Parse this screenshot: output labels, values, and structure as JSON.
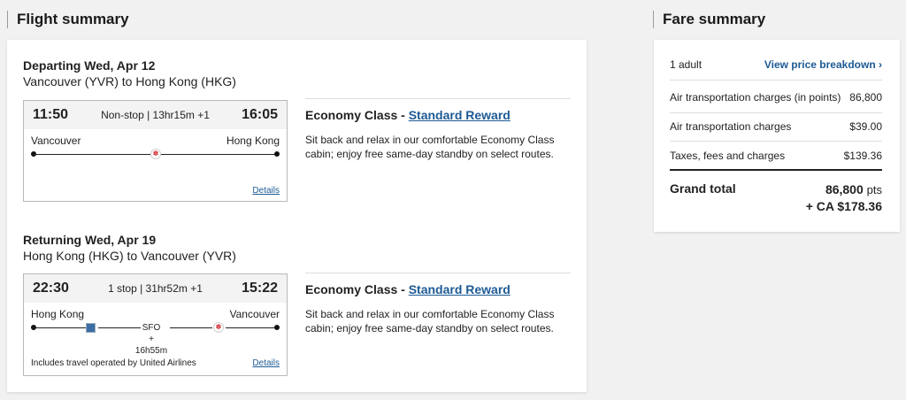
{
  "flight_summary": {
    "title": "Flight summary",
    "outbound": {
      "heading_date": "Departing Wed, Apr 12",
      "route": "Vancouver (YVR) to Hong Kong (HKG)",
      "dep_time": "11:50",
      "arr_time": "16:05",
      "stops": "Non-stop | 13hr15m +1",
      "origin": "Vancouver",
      "destination": "Hong Kong",
      "details_label": "Details",
      "cabin": "Economy Class - ",
      "reward": "Standard Reward",
      "description": "Sit back and relax in our comfortable Economy Class cabin; enjoy free same-day standby on select routes."
    },
    "return": {
      "heading_date": "Returning Wed, Apr 19",
      "route": "Hong Kong (HKG) to Vancouver (YVR)",
      "dep_time": "22:30",
      "arr_time": "15:22",
      "stops": "1 stop | 31hr52m +1",
      "origin": "Hong Kong",
      "destination": "Vancouver",
      "layover_airport": "SFO",
      "layover_duration": "+ 16h55m",
      "operated_by": "Includes travel operated by United Airlines",
      "details_label": "Details",
      "cabin": "Economy Class - ",
      "reward": "Standard Reward",
      "description": "Sit back and relax in our comfortable Economy Class cabin; enjoy free same-day standby on select routes."
    }
  },
  "fare_summary": {
    "title": "Fare summary",
    "passengers": "1 adult",
    "breakdown_link": "View price breakdown",
    "rows": [
      {
        "label": "Air transportation charges (in points)",
        "value": "86,800"
      },
      {
        "label": "Air transportation charges",
        "value": "$39.00"
      },
      {
        "label": "Taxes, fees and charges",
        "value": "$139.36"
      }
    ],
    "grand_total_label": "Grand total",
    "grand_total_points": "86,800",
    "points_unit": "pts",
    "grand_total_cash": "+ CA $178.36"
  },
  "colors": {
    "link": "#1d5a94",
    "leaf": "#d22630"
  }
}
